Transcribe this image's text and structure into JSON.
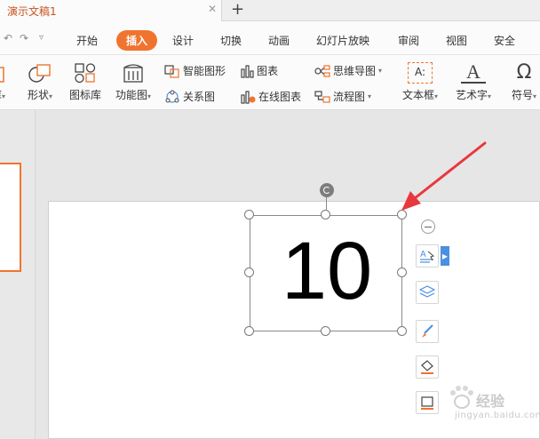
{
  "document": {
    "title": "演示文稿1",
    "new_tab_icon": "plus-icon"
  },
  "menu": {
    "items": [
      {
        "id": "start",
        "label": "开始"
      },
      {
        "id": "insert",
        "label": "插入",
        "active": true
      },
      {
        "id": "design",
        "label": "设计"
      },
      {
        "id": "switch",
        "label": "切换"
      },
      {
        "id": "animation",
        "label": "动画"
      },
      {
        "id": "slideshow",
        "label": "幻灯片放映"
      },
      {
        "id": "review",
        "label": "审阅"
      },
      {
        "id": "view",
        "label": "视图"
      },
      {
        "id": "security",
        "label": "安全"
      }
    ],
    "active_color": "#f0742f"
  },
  "ribbon": {
    "shape": "形状",
    "icon_library": "图标库",
    "function_chart": "功能图",
    "smart_shape": "智能图形",
    "chart": "图表",
    "relation_chart": "关系图",
    "online_chart": "在线图表",
    "mind_map": "思维导图",
    "flowchart": "流程图",
    "text_box": "文本框",
    "art_text": "艺术字",
    "symbol": "符号",
    "left_cut_label": "库",
    "text_box_icon_text": "A:",
    "art_text_icon_text": "A",
    "symbol_icon_text": "Ω"
  },
  "slide": {
    "text": "10"
  },
  "watermark": {
    "text": "经验",
    "url": "jingyan.baidu.com"
  },
  "colors": {
    "accent": "#f0742f",
    "arrow": "#e8383d",
    "tab_title": "#c8511a"
  }
}
